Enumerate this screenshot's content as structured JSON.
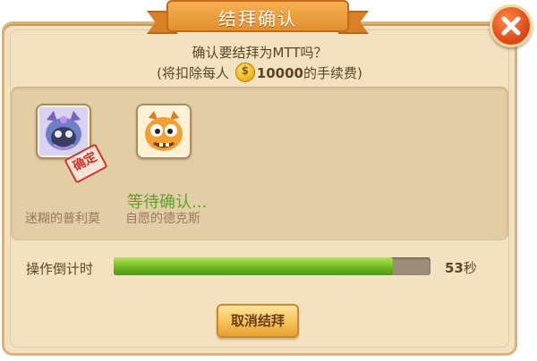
{
  "dialog": {
    "title": "结拜确认",
    "question": "确认要结拜为MTT吗？",
    "fee_prefix": "(将扣除每人",
    "fee_amount": "10000",
    "fee_suffix": "的手续费)",
    "coin_symbol": "$"
  },
  "players": [
    {
      "name": "迷糊的普利莫",
      "stamp": "确定"
    },
    {
      "name": "自愿的德克斯",
      "status": "等待确认..."
    }
  ],
  "countdown": {
    "label": "操作倒计时",
    "seconds_value": "53",
    "seconds_unit": "秒",
    "progress_fraction": 0.88
  },
  "buttons": {
    "cancel": "取消结拜"
  },
  "colors": {
    "accent": "#e38f2e",
    "progress": "#6fbb1f",
    "waiting": "#5fa12a",
    "stamp": "#d0362a"
  },
  "icons": [
    "close-icon",
    "coin-icon"
  ]
}
